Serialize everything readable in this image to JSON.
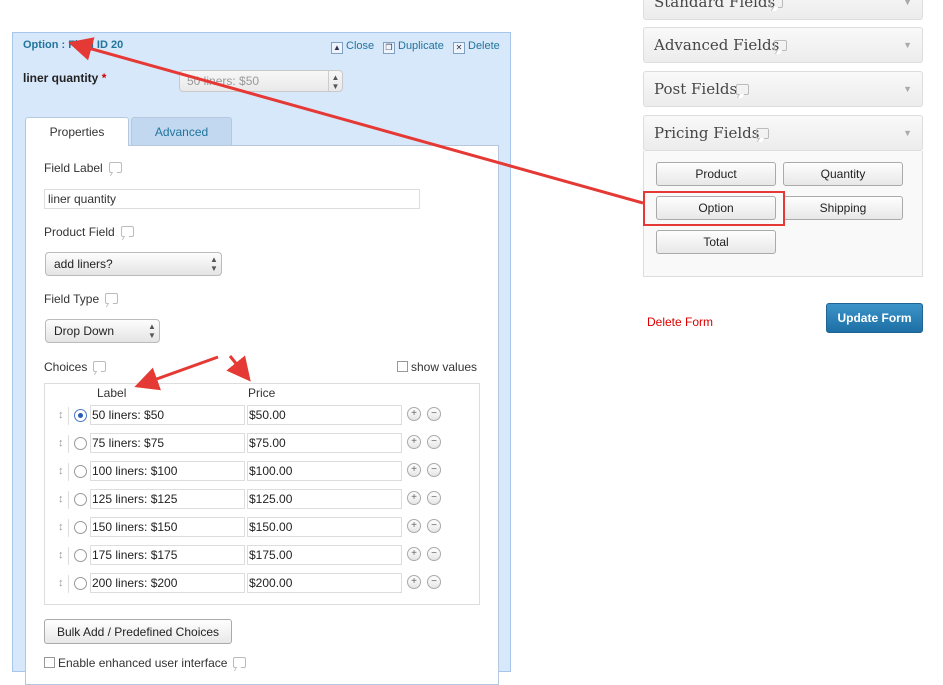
{
  "editor": {
    "title": "Option : Field ID 20",
    "actions": {
      "close": "Close",
      "duplicate": "Duplicate",
      "delete": "Delete"
    },
    "field_name": "liner quantity",
    "required_marker": "*",
    "preview_value": "50 liners: $50",
    "tabs": {
      "properties": "Properties",
      "advanced": "Advanced"
    }
  },
  "properties": {
    "field_label_title": "Field Label",
    "field_label_value": "liner quantity",
    "product_field_title": "Product Field",
    "product_field_value": "add liners?",
    "field_type_title": "Field Type",
    "field_type_value": "Drop Down",
    "choices_title": "Choices",
    "show_values_label": "show values",
    "col_label": "Label",
    "col_price": "Price",
    "choices": [
      {
        "label": "50 liners: $50",
        "price": "$50.00",
        "selected": true
      },
      {
        "label": "75 liners: $75",
        "price": "$75.00",
        "selected": false
      },
      {
        "label": "100 liners: $100",
        "price": "$100.00",
        "selected": false
      },
      {
        "label": "125 liners: $125",
        "price": "$125.00",
        "selected": false
      },
      {
        "label": "150 liners: $150",
        "price": "$150.00",
        "selected": false
      },
      {
        "label": "175 liners: $175",
        "price": "$175.00",
        "selected": false
      },
      {
        "label": "200 liners: $200",
        "price": "$200.00",
        "selected": false
      }
    ],
    "bulk_add": "Bulk Add / Predefined Choices",
    "enhanced_ui": "Enable enhanced user interface"
  },
  "sidebar": {
    "groups": {
      "standard": "Standard Fields",
      "advanced": "Advanced Fields",
      "post": "Post Fields",
      "pricing": "Pricing Fields"
    },
    "pricing_buttons": [
      "Product",
      "Quantity",
      "Option",
      "Shipping",
      "Total"
    ],
    "delete_form": "Delete Form",
    "update_form": "Update Form"
  },
  "colors": {
    "accent": "#21759b",
    "annotation": "#e53935",
    "delete": "#dd0000",
    "editor_bg": "#d8e8fb"
  }
}
